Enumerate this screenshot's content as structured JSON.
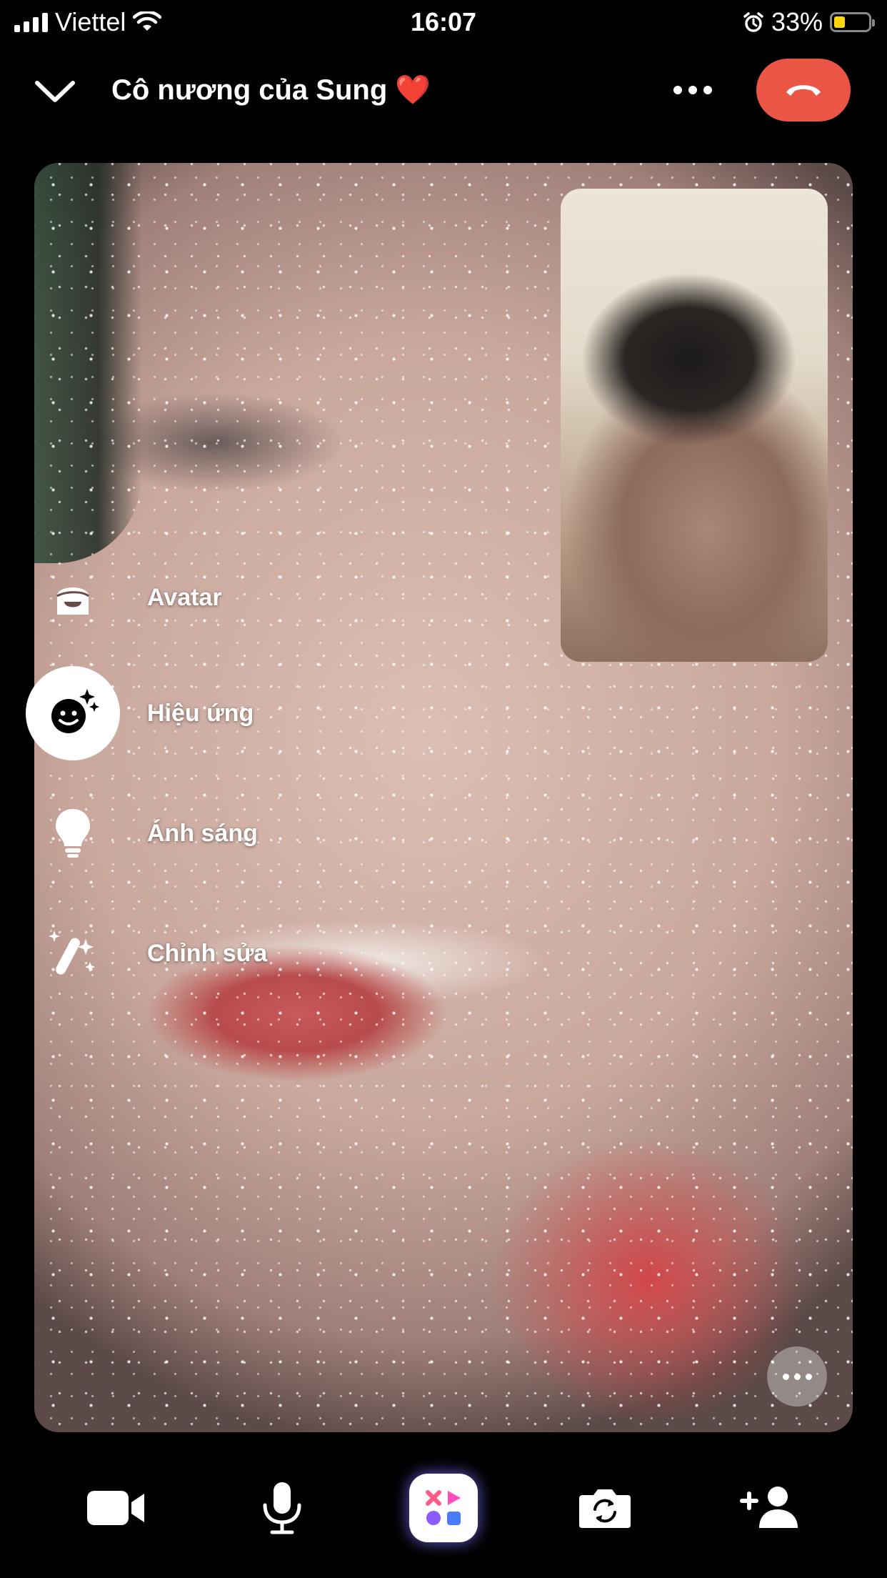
{
  "status_bar": {
    "carrier": "Viettel",
    "time": "16:07",
    "battery_percent": "33%",
    "battery_level": 0.33,
    "battery_color": "#ffd60a",
    "icons": [
      "signal-icon",
      "wifi-icon",
      "alarm-icon",
      "battery-icon"
    ]
  },
  "header": {
    "title": "Cô nương của Sung ❤️",
    "end_call_color": "#eb5545",
    "icons": [
      "chevron-down-icon",
      "more-icon",
      "end-call-icon"
    ]
  },
  "effects_menu": {
    "items": [
      {
        "label": "Avatar",
        "icon": "avatar-icon",
        "selected": false
      },
      {
        "label": "Hiệu ứng",
        "icon": "effects-face-icon",
        "selected": true
      },
      {
        "label": "Ánh sáng",
        "icon": "lightbulb-icon",
        "selected": false
      },
      {
        "label": "Chỉnh sửa",
        "icon": "magic-wand-icon",
        "selected": false
      }
    ]
  },
  "bottom_bar": {
    "buttons": [
      "camera-icon",
      "microphone-icon",
      "effects-icon",
      "flip-camera-icon",
      "add-person-icon"
    ]
  }
}
